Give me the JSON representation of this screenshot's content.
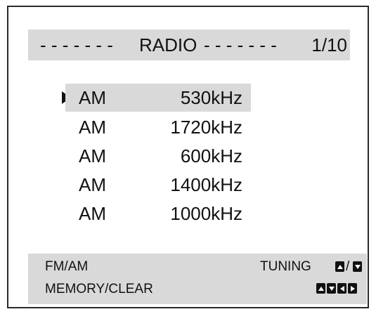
{
  "header": {
    "dashes_left": "- - - - - - -",
    "title": "RADIO",
    "dashes_right": "- - - - - - -",
    "page_indicator": "1/10"
  },
  "presets": [
    {
      "band": "AM",
      "frequency": "530kHz",
      "selected": true
    },
    {
      "band": "AM",
      "frequency": "1720kHz",
      "selected": false
    },
    {
      "band": "AM",
      "frequency": "600kHz",
      "selected": false
    },
    {
      "band": "AM",
      "frequency": "1400kHz",
      "selected": false
    },
    {
      "band": "AM",
      "frequency": "1000kHz",
      "selected": false
    }
  ],
  "footer": {
    "fm_am_label": "FM/AM",
    "tuning_label": "TUNING",
    "tuning_separator": "/",
    "memory_clear_label": "MEMORY/CLEAR",
    "tuning_icons": [
      "up-arrow-key-icon",
      "down-arrow-key-icon"
    ],
    "memory_clear_icons": [
      "up-arrow-key-icon",
      "down-arrow-key-icon",
      "left-arrow-key-icon",
      "right-arrow-key-icon"
    ]
  },
  "colors": {
    "highlight_bg": "#d9d9d9",
    "text": "#111111",
    "frame_border": "#2a2a2a"
  }
}
